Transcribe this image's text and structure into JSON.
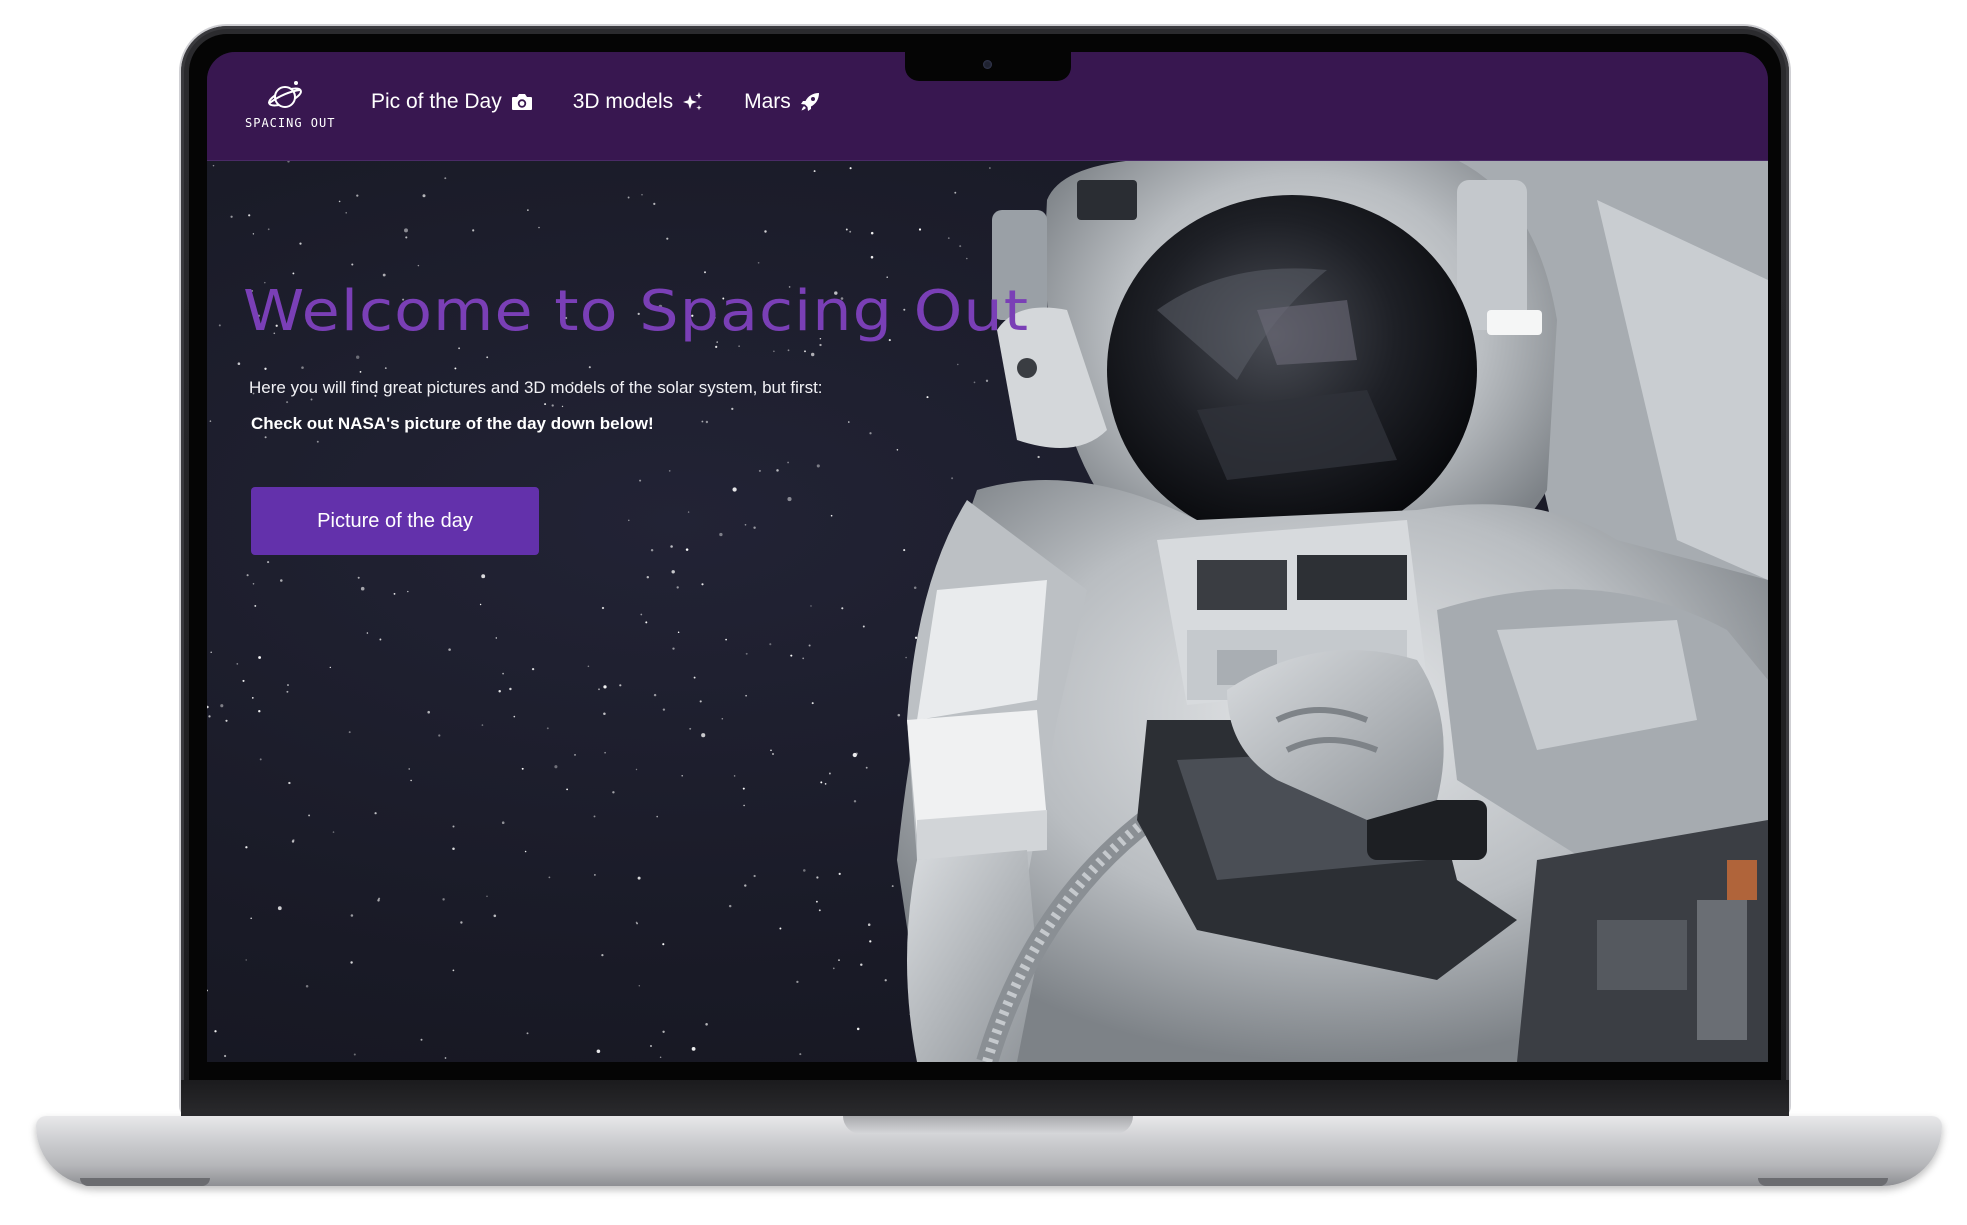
{
  "brand": {
    "name": "SPACING OUT"
  },
  "nav": {
    "items": [
      {
        "label": "Pic of the Day",
        "icon": "camera-icon"
      },
      {
        "label": "3D models",
        "icon": "sparkles-icon"
      },
      {
        "label": "Mars",
        "icon": "rocket-icon"
      }
    ]
  },
  "hero": {
    "title": "Welcome to Spacing Out",
    "subtitle": "Here you will find great pictures and 3D models of the solar system, but first:",
    "callout": "Check out NASA's picture of the day down below!",
    "button_label": "Picture of the day",
    "image": "astronaut-photo"
  },
  "colors": {
    "navbar_bg": "#381750",
    "page_bg": "#191a26",
    "accent_title": "#7a3fb6",
    "button_bg": "#6331ab",
    "text": "#ffffff"
  }
}
